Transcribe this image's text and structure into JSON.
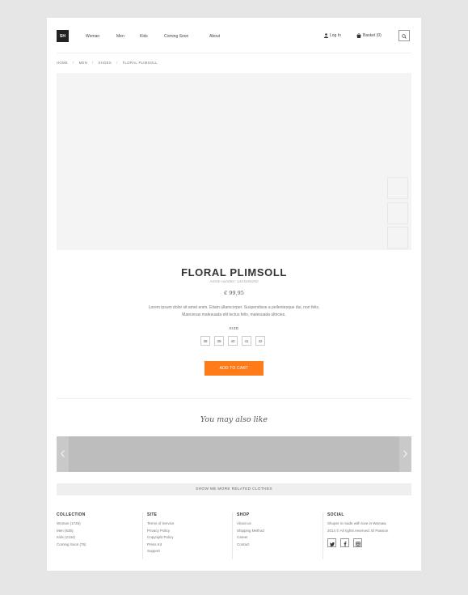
{
  "header": {
    "logo": "SH",
    "nav": [
      "Woman",
      "Men",
      "Kids",
      "Coming Soon",
      "About"
    ],
    "login_label": "Log In",
    "basket_label": "Basket (0)"
  },
  "breadcrumb": [
    "HOME",
    "MEN",
    "SHOES",
    "FLORAL PLIMSOLL"
  ],
  "product": {
    "title": "FLORAL PLIMSOLL",
    "article": "Article number: 1423456292",
    "price": "€ 99,95",
    "description_line1": "Lorem ipsum dolor sit amet enim. Etiam ullamcorper. Suspendisse a pellentesque dui, non felis.",
    "description_line2": "Maecenas malesuada elit lectus felis, malesuada ultricies.",
    "size_label": "SIZE",
    "sizes": [
      "38",
      "39",
      "40",
      "41",
      "42"
    ],
    "add_to_cart": "ADD TO CART"
  },
  "related": {
    "title": "You may also like",
    "more_button": "SHOW ME MORE RELATED CLOTHES"
  },
  "footer": {
    "collection": {
      "title": "COLLECTION",
      "links": [
        "Woman (1725)",
        "Men (635)",
        "Kids (2134)",
        "Coming Soon (76)"
      ]
    },
    "site": {
      "title": "SITE",
      "links": [
        "Terms of Service",
        "Privacy Policy",
        "Copyright Policy",
        "Press Kit",
        "Support"
      ]
    },
    "shop": {
      "title": "SHOP",
      "links": [
        "About us",
        "Shipping Method",
        "Career",
        "Contact"
      ]
    },
    "social": {
      "title": "SOCIAL",
      "line1": "Shoper is made with love in Warsaw,",
      "line2": "2014 © All rights reserved. El Passion",
      "icons": [
        "twitter-icon",
        "facebook-icon",
        "instagram-icon"
      ]
    }
  },
  "colors": {
    "accent": "#ff7b19",
    "background": "#e6e6e6",
    "carousel": "#bdbdbd"
  }
}
